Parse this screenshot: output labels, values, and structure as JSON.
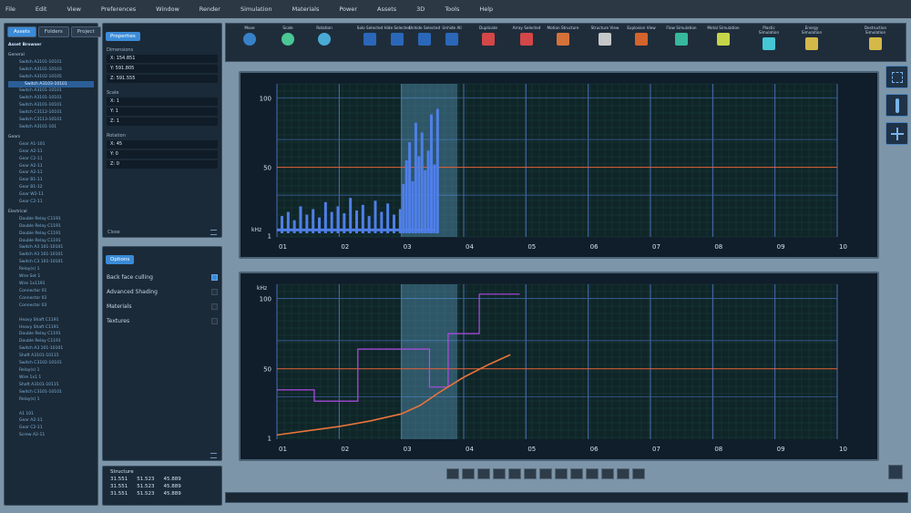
{
  "menu": [
    "File",
    "Edit",
    "View",
    "Preferences",
    "Window",
    "Render",
    "Simulation",
    "Materials",
    "Power",
    "Assets",
    "3D",
    "Tools",
    "Help"
  ],
  "assets": {
    "tabs": [
      "Assets",
      "Folders",
      "Project"
    ],
    "header": "Asset Browser",
    "groups": [
      {
        "name": "General",
        "items": [
          "Switch A3101-10101",
          "Switch A3101-10103",
          "Switch A3102-10105",
          "Switch A3103-10101",
          "Switch A3101-10101",
          "Switch A3101-10101",
          "Switch A3101-10101",
          "Switch C3112-10101",
          "Switch C3113-10101",
          "Switch A3101-101"
        ]
      },
      {
        "name": "Gears",
        "items": [
          "Gear A1-101",
          "Gear A2-11",
          "Gear C2-11",
          "Gear A2-11",
          "Gear A2-11",
          "Gear B1-11",
          "Gear B1-12",
          "Gear W2-11",
          "Gear C2-11"
        ]
      },
      {
        "name": "Electrical",
        "items": [
          "Double Relay C1191",
          "Double Relay C1191",
          "Double Relay C1191",
          "Double Relay C1191",
          "Switch A3 101-10101",
          "Switch A3 101-10101",
          "Switch C3 101-10101",
          "Relay(s) 1",
          "Wire Set 1",
          "Wire 1x1191",
          "Connector 01",
          "Connector 02",
          "Connector 03"
        ]
      },
      {
        "name": "",
        "items": [
          "Heavy Shaft C1191",
          "Heavy Shaft C1191",
          "Double Relay C1191",
          "Double Relay C1191",
          "Switch A3 101-10101",
          "Shaft A3101-10115",
          "Switch C3102-10101",
          "Relay(s) 1",
          "Wire 1x1 1",
          "Shaft A3101-10115",
          "Switch C3101-10101",
          "Relay(s) 1"
        ]
      },
      {
        "name": "",
        "items": [
          "A1 101",
          "Gear A2-11",
          "Gear C2-11",
          "Screw A2-11"
        ]
      }
    ]
  },
  "properties": {
    "title": "Properties",
    "dimensions_label": "Dimensions",
    "dimensions": [
      "X: 154.851",
      "Y: 591.805",
      "Z: 591.555"
    ],
    "scale_label": "Scale",
    "scale": [
      "X: 1",
      "Y: 1",
      "Z: 1"
    ],
    "rotation_label": "Rotation",
    "rotation": [
      "X: 45",
      "Y: 0",
      "Z: 0"
    ],
    "close": "Close"
  },
  "options": {
    "title": "Options",
    "items": [
      {
        "label": "Back face culling",
        "checked": true
      },
      {
        "label": "Advanced Shading",
        "checked": false
      },
      {
        "label": "Materials",
        "checked": false
      },
      {
        "label": "Textures",
        "checked": false
      }
    ]
  },
  "structure": {
    "title": "Structure",
    "rows": [
      [
        "31.551",
        "51.523",
        "45.889"
      ],
      [
        "31.551",
        "51.523",
        "45.889"
      ],
      [
        "31.551",
        "51.523",
        "45.889"
      ]
    ]
  },
  "toolbar": [
    {
      "label": "Move",
      "icon": "move-icon",
      "color": "#3a8bd8"
    },
    {
      "label": "Scale",
      "icon": "scale-icon",
      "color": "#4fd8a0"
    },
    {
      "label": "Rotation",
      "icon": "rotation-icon",
      "color": "#4fb8e8"
    },
    {
      "label": "Solo Selected",
      "icon": "solo-icon",
      "color": "#2b6ec8"
    },
    {
      "label": "Hide Selected",
      "icon": "hide-icon",
      "color": "#2b6ec8"
    },
    {
      "label": "Unhide Selected",
      "icon": "unhide-icon",
      "color": "#2b6ec8"
    },
    {
      "label": "Unhide All",
      "icon": "unhide-all-icon",
      "color": "#2b6ec8"
    },
    {
      "label": "Duplicate",
      "icon": "duplicate-icon",
      "color": "#e84a4a"
    },
    {
      "label": "Array Selected",
      "icon": "array-icon",
      "color": "#e84a4a"
    },
    {
      "label": "Motion Structure",
      "icon": "motion-icon",
      "color": "#e87a3a"
    },
    {
      "label": "Structure View",
      "icon": "structure-icon",
      "color": "#d8d8d8"
    },
    {
      "label": "Explosion View",
      "icon": "explosion-icon",
      "color": "#e86a2a"
    },
    {
      "label": "Flow Simulation",
      "icon": "flow-icon",
      "color": "#3ac8a8"
    },
    {
      "label": "Metal Simulation",
      "icon": "metal-icon",
      "color": "#d8e84a"
    },
    {
      "label": "Plastic Simulation",
      "icon": "plastic-icon",
      "color": "#4ad8e8"
    },
    {
      "label": "Energy Simulation",
      "icon": "energy-icon",
      "color": "#e8c84a"
    },
    {
      "label": "Destruction Simulation",
      "icon": "destruction-icon",
      "color": "#e8c84a"
    }
  ],
  "chart_data": [
    {
      "type": "bar",
      "ylabel": "kHz",
      "yticks": [
        "100",
        "50",
        "1"
      ],
      "xticks": [
        "01",
        "02",
        "03",
        "04",
        "05",
        "06",
        "07",
        "08",
        "09",
        "10"
      ],
      "ylim": [
        0,
        110
      ],
      "highlight_band": [
        3.0,
        3.9
      ],
      "threshold": 50,
      "grid": true,
      "colors": {
        "bars": "#4f7fe8",
        "threshold": "#e8643a",
        "band": "#6ab2dc"
      },
      "x": [
        1.0,
        1.1,
        1.2,
        1.3,
        1.4,
        1.5,
        1.6,
        1.7,
        1.8,
        1.9,
        2.0,
        2.1,
        2.2,
        2.3,
        2.4,
        2.5,
        2.6,
        2.7,
        2.8,
        2.9,
        2.95,
        3.0,
        3.05,
        3.1,
        3.15,
        3.2,
        3.25,
        3.3,
        3.35,
        3.4,
        3.45,
        3.5
      ],
      "values": [
        15,
        18,
        12,
        22,
        16,
        20,
        14,
        25,
        18,
        22,
        17,
        28,
        19,
        23,
        15,
        26,
        18,
        24,
        16,
        20,
        38,
        55,
        68,
        40,
        82,
        58,
        75,
        48,
        62,
        88,
        52,
        92
      ]
    },
    {
      "type": "line",
      "ylabel": "kHz",
      "yticks": [
        "100",
        "50",
        "1"
      ],
      "xticks": [
        "01",
        "02",
        "03",
        "04",
        "05",
        "06",
        "07",
        "08",
        "09",
        "10"
      ],
      "ylim": [
        0,
        110
      ],
      "highlight_band": [
        3.0,
        3.9
      ],
      "threshold": 50,
      "grid": true,
      "series": [
        {
          "color": "#b04ae8",
          "x": [
            1.0,
            1.0,
            1.6,
            1.6,
            2.3,
            2.3,
            3.45,
            3.45,
            3.75,
            3.75,
            4.25,
            4.25,
            4.9
          ],
          "y": [
            35,
            35,
            35,
            27,
            27,
            64,
            64,
            37,
            37,
            75,
            75,
            103,
            103
          ]
        },
        {
          "color": "#e8743a",
          "x": [
            1.0,
            1.5,
            2.0,
            2.5,
            3.0,
            3.3,
            3.6,
            4.0,
            4.4,
            4.75
          ],
          "y": [
            3,
            6,
            9,
            13,
            18,
            24,
            33,
            44,
            53,
            60
          ]
        }
      ]
    }
  ]
}
